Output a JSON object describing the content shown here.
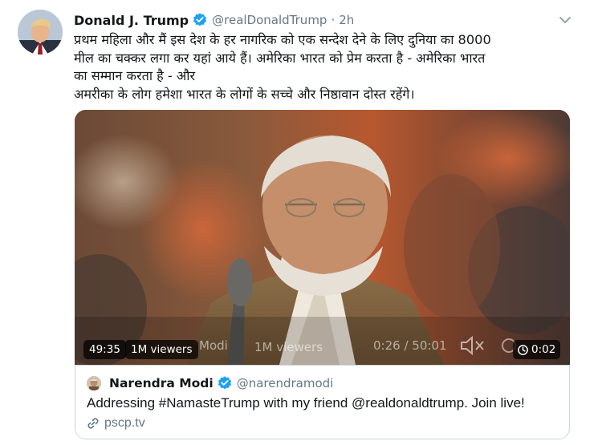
{
  "tweet": {
    "author_name": "Donald J. Trump",
    "handle": "@realDonaldTrump",
    "separator": "·",
    "time": "2h",
    "text_lines": [
      "प्रथम महिला और मैं इस देश के हर नागरिक को एक सन्देश देने के लिए दुनिया का 8000",
      "मील का चक्कर लगा कर यहां आये हैं। अमेरिका भारत को प्रेम करता है - अमेरिका भारत",
      "का सम्मान करता है - और",
      "अमरीका के लोग हमेशा भारत के लोगों के सच्चे और निष्ठावान दोस्त रहेंगे।"
    ]
  },
  "video": {
    "duration": "49:35",
    "viewers": "1M viewers",
    "overlay_name": "Modi",
    "overlay_viewers": "1M viewers",
    "overlay_time": "0:26 / 50:01",
    "replay_time": "0:02"
  },
  "quoted": {
    "name": "Narendra Modi",
    "handle": "@narendramodi",
    "text": "Addressing #NamasteTrump with my friend @realdonaldtrump. Join live!",
    "link": "pscp.tv"
  },
  "colors": {
    "verified": "#1da1f2",
    "secondary_text": "#657786",
    "border": "#ccd6dd"
  },
  "icons": {
    "verified": "verified-badge-icon",
    "more": "chevron-down-icon",
    "link": "link-icon",
    "mute": "speaker-muted-icon",
    "replay": "replay-clock-icon"
  }
}
